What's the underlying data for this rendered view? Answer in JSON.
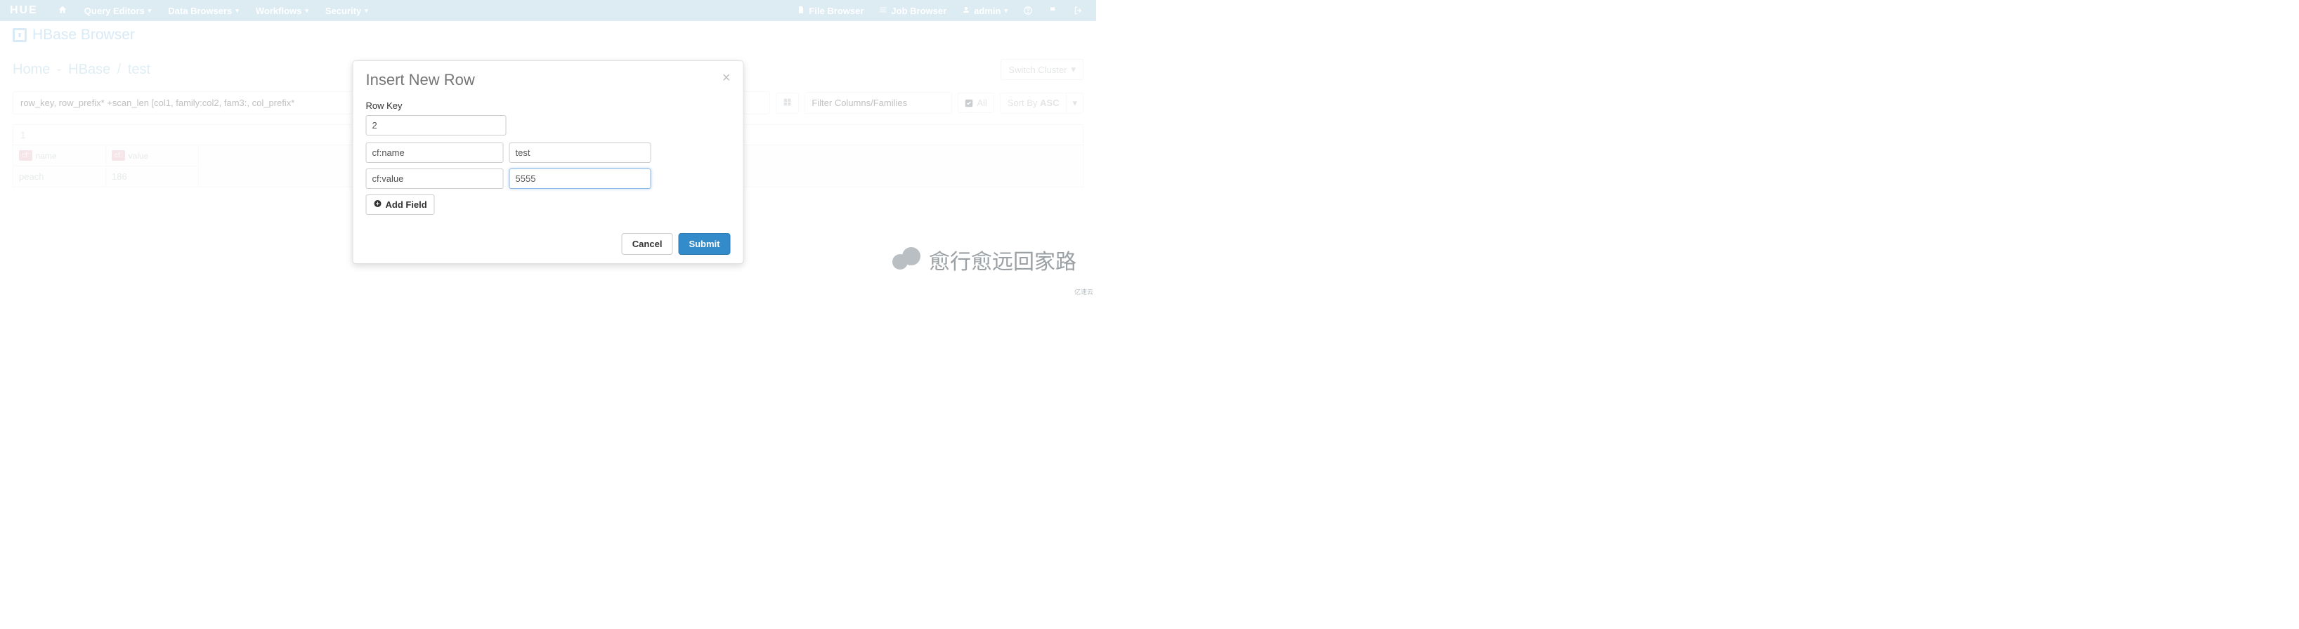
{
  "brand": "HUE",
  "nav": {
    "items": [
      {
        "label": "Query Editors"
      },
      {
        "label": "Data Browsers"
      },
      {
        "label": "Workflows"
      },
      {
        "label": "Security"
      }
    ],
    "file_browser": "File Browser",
    "job_browser": "Job Browser",
    "admin": "admin"
  },
  "subheader": {
    "title": "HBase Browser"
  },
  "breadcrumb": {
    "home": "Home",
    "cluster": "HBase",
    "table": "test"
  },
  "switch_cluster": "Switch Cluster",
  "filters": {
    "main_placeholder": "row_key, row_prefix* +scan_len [col1, family:col2, fam3:, col_prefix*",
    "cols_placeholder": "Filter Columns/Families",
    "all_label": "All",
    "sort_label": "Sort By",
    "sort_dir": "ASC"
  },
  "data": {
    "row_key": "1",
    "columns": [
      {
        "family": "cf:",
        "name": "name",
        "value": "peach"
      },
      {
        "family": "cf:",
        "name": "value",
        "value": "186"
      }
    ]
  },
  "modal": {
    "title": "Insert New Row",
    "row_key_label": "Row Key",
    "row_key_value": "2",
    "fields": [
      {
        "col": "cf:name",
        "val": "test"
      },
      {
        "col": "cf:value",
        "val": "5555"
      }
    ],
    "add_field": "Add Field",
    "cancel": "Cancel",
    "submit": "Submit"
  },
  "watermark": "愈行愈远回家路",
  "corner": "亿速云"
}
